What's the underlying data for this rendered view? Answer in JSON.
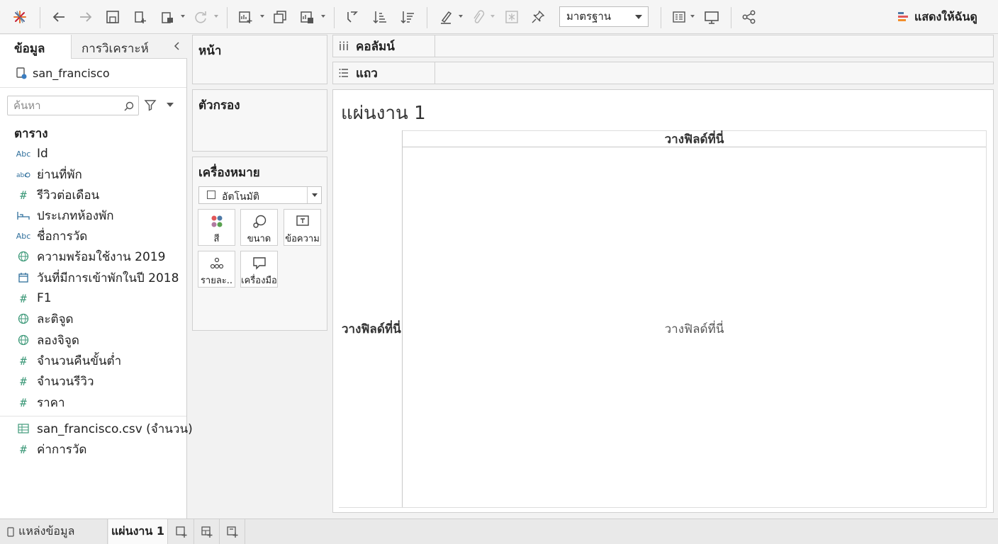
{
  "toolbar": {
    "fit_select": "มาตรฐาน",
    "show_me": "แสดงให้ฉันดู"
  },
  "datapane": {
    "tab_data": "ข้อมูล",
    "tab_analytics": "การวิเคราะห์",
    "datasource": "san_francisco",
    "search_placeholder": "ค้นหา",
    "tables_header": "ตาราง",
    "fields": [
      {
        "label": "Id",
        "icon": "abc-icon"
      },
      {
        "label": "ย่านที่พัก",
        "icon": "geo-string-icon"
      },
      {
        "label": "รีวิวต่อเดือน",
        "icon": "number-icon"
      },
      {
        "label": "ประเภทห้องพัก",
        "icon": "bed-icon"
      },
      {
        "label": "ชื่อการวัด",
        "icon": "abc-icon"
      },
      {
        "label": "ความพร้อมใช้งาน 2019",
        "icon": "globe-icon"
      },
      {
        "label": "วันที่มีการเข้าพักในปี 2018",
        "icon": "calendar-icon"
      },
      {
        "label": "F1",
        "icon": "number-icon"
      },
      {
        "label": "ละติจูด",
        "icon": "globe-icon"
      },
      {
        "label": "ลองจิจูด",
        "icon": "globe-icon"
      },
      {
        "label": "จำนวนคืนขั้นต่ำ",
        "icon": "number-icon"
      },
      {
        "label": "จำนวนรีวิว",
        "icon": "number-icon"
      },
      {
        "label": "ราคา",
        "icon": "number-icon"
      }
    ],
    "extra_fields": [
      {
        "label": "san_francisco.csv (จำนวน)",
        "icon": "table-icon"
      },
      {
        "label": "ค่าการวัด",
        "icon": "number-icon"
      }
    ]
  },
  "cards": {
    "pages": "หน้า",
    "filters": "ตัวกรอง",
    "marks": "เครื่องหมาย",
    "marks_type": "อัตโนมัติ",
    "mark_buttons": {
      "color": "สี",
      "size": "ขนาด",
      "label": "ข้อความ",
      "detail": "รายละ..",
      "tooltip": "เครื่องมือ"
    }
  },
  "shelves": {
    "columns": "คอลัมน์",
    "rows": "แถว"
  },
  "sheet": {
    "title": "แผ่นงาน 1",
    "drop_field_col": "วางฟิลด์ที่นี่",
    "drop_field_row": "วางฟิลด์ที่นี่",
    "drop_field_center": "วางฟิลด์ที่นี่"
  },
  "bottom": {
    "datasource_tab": "แหล่งข้อมูล",
    "sheet_tab": "แผ่นงาน 1"
  }
}
